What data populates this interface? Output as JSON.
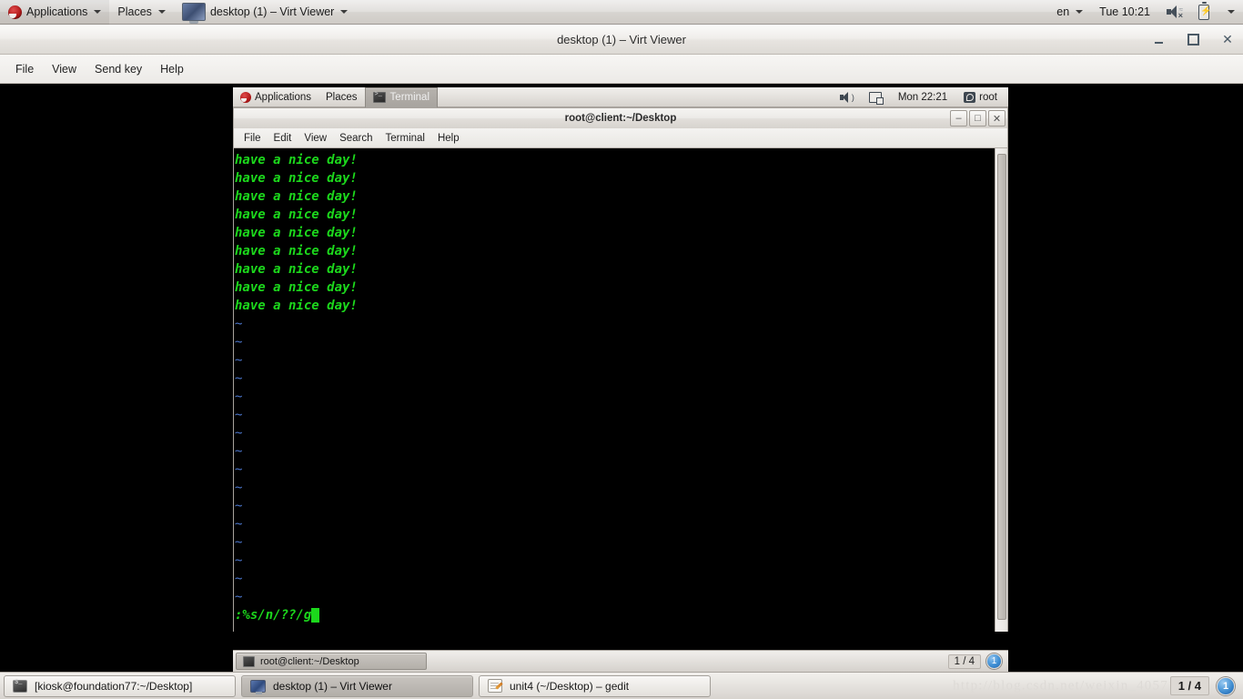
{
  "host_panel": {
    "applications_label": "Applications",
    "places_label": "Places",
    "window_menu_label": "desktop (1) – Virt Viewer",
    "keyboard_layout": "en",
    "clock": "Tue 10:21"
  },
  "virt_viewer": {
    "title": "desktop (1) – Virt Viewer",
    "menu": [
      "File",
      "View",
      "Send key",
      "Help"
    ],
    "close_glyph": "✕"
  },
  "guest_panel": {
    "applications_label": "Applications",
    "places_label": "Places",
    "active_window_label": "Terminal",
    "clock": "Mon 22:21",
    "user": "root"
  },
  "terminal": {
    "title": "root@client:~/Desktop",
    "menu": [
      "File",
      "Edit",
      "View",
      "Search",
      "Terminal",
      "Help"
    ],
    "min_glyph": "–",
    "max_glyph": "□",
    "close_glyph": "✕",
    "text_lines": [
      "have a nice day!",
      "have a nice day!",
      "have a nice day!",
      "have a nice day!",
      "have a nice day!",
      "have a nice day!",
      "have a nice day!",
      "have a nice day!",
      "have a nice day!"
    ],
    "empty_marker": "~",
    "empty_marker_count": 16,
    "command_line": ":%s/n/??/g"
  },
  "guest_taskbar": {
    "window_button": "root@client:~/Desktop",
    "workspace": "1 / 4",
    "badge": "1"
  },
  "host_taskbar": {
    "buttons": [
      {
        "label": "[kiosk@foundation77:~/Desktop]",
        "icon": "terminal-icon",
        "active": false
      },
      {
        "label": "desktop (1) – Virt Viewer",
        "icon": "virt-viewer-icon",
        "active": true
      },
      {
        "label": "unit4 (~/Desktop) – gedit",
        "icon": "gedit-icon",
        "active": false
      }
    ],
    "watermark": "http://blog.csdn.net/weixin_4057167",
    "workspace": "1 / 4",
    "badge": "1"
  },
  "colors": {
    "terminal_bg": "#000000",
    "terminal_green": "#1cd81c",
    "vim_tilde_blue": "#4a74c9",
    "panel_gray": "#e4e1dd",
    "accent_blue": "#428fd2"
  }
}
